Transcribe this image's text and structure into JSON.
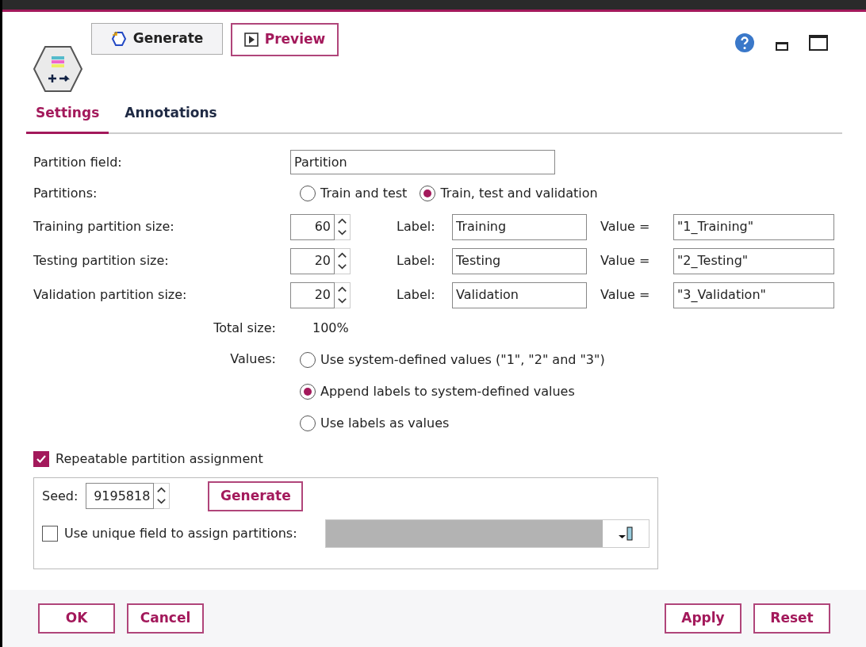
{
  "toolbar": {
    "buttons": [
      {
        "label": "Generate",
        "kind": "generate"
      },
      {
        "label": "Preview",
        "kind": "preview"
      }
    ]
  },
  "tabs": [
    {
      "label": "Settings",
      "selected": true
    },
    {
      "label": "Annotations",
      "selected": false
    }
  ],
  "partition_field": {
    "label": "Partition field:",
    "value": "Partition"
  },
  "partitions": {
    "label": "Partitions:",
    "options": [
      {
        "label": "Train and test",
        "selected": false
      },
      {
        "label": "Train, test and validation",
        "selected": true
      }
    ]
  },
  "sizes": [
    {
      "label": "Training partition size:",
      "size": "60",
      "label_caption": "Label:",
      "label_value": "Training",
      "value_caption": "Value =",
      "value": "\"1_Training\""
    },
    {
      "label": "Testing partition size:",
      "size": "20",
      "label_caption": "Label:",
      "label_value": "Testing",
      "value_caption": "Value =",
      "value": "\"2_Testing\""
    },
    {
      "label": "Validation partition size:",
      "size": "20",
      "label_caption": "Label:",
      "label_value": "Validation",
      "value_caption": "Value =",
      "value": "\"3_Validation\""
    }
  ],
  "total": {
    "label": "Total size:",
    "value": "100%"
  },
  "values": {
    "label": "Values:",
    "options": [
      {
        "label": "Use system-defined values (\"1\", \"2\" and \"3\")",
        "selected": false
      },
      {
        "label": "Append labels to system-defined values",
        "selected": true
      },
      {
        "label": "Use labels as values",
        "selected": false
      }
    ]
  },
  "repeatable": {
    "label": "Repeatable partition assignment",
    "checked": true
  },
  "seed": {
    "label": "Seed:",
    "value": "9195818",
    "button": "Generate"
  },
  "unique_field": {
    "label": "Use unique field to assign partitions:",
    "checked": false,
    "disabled": true
  },
  "footer": {
    "left": [
      "OK",
      "Cancel"
    ],
    "right": [
      "Apply",
      "Reset"
    ]
  }
}
